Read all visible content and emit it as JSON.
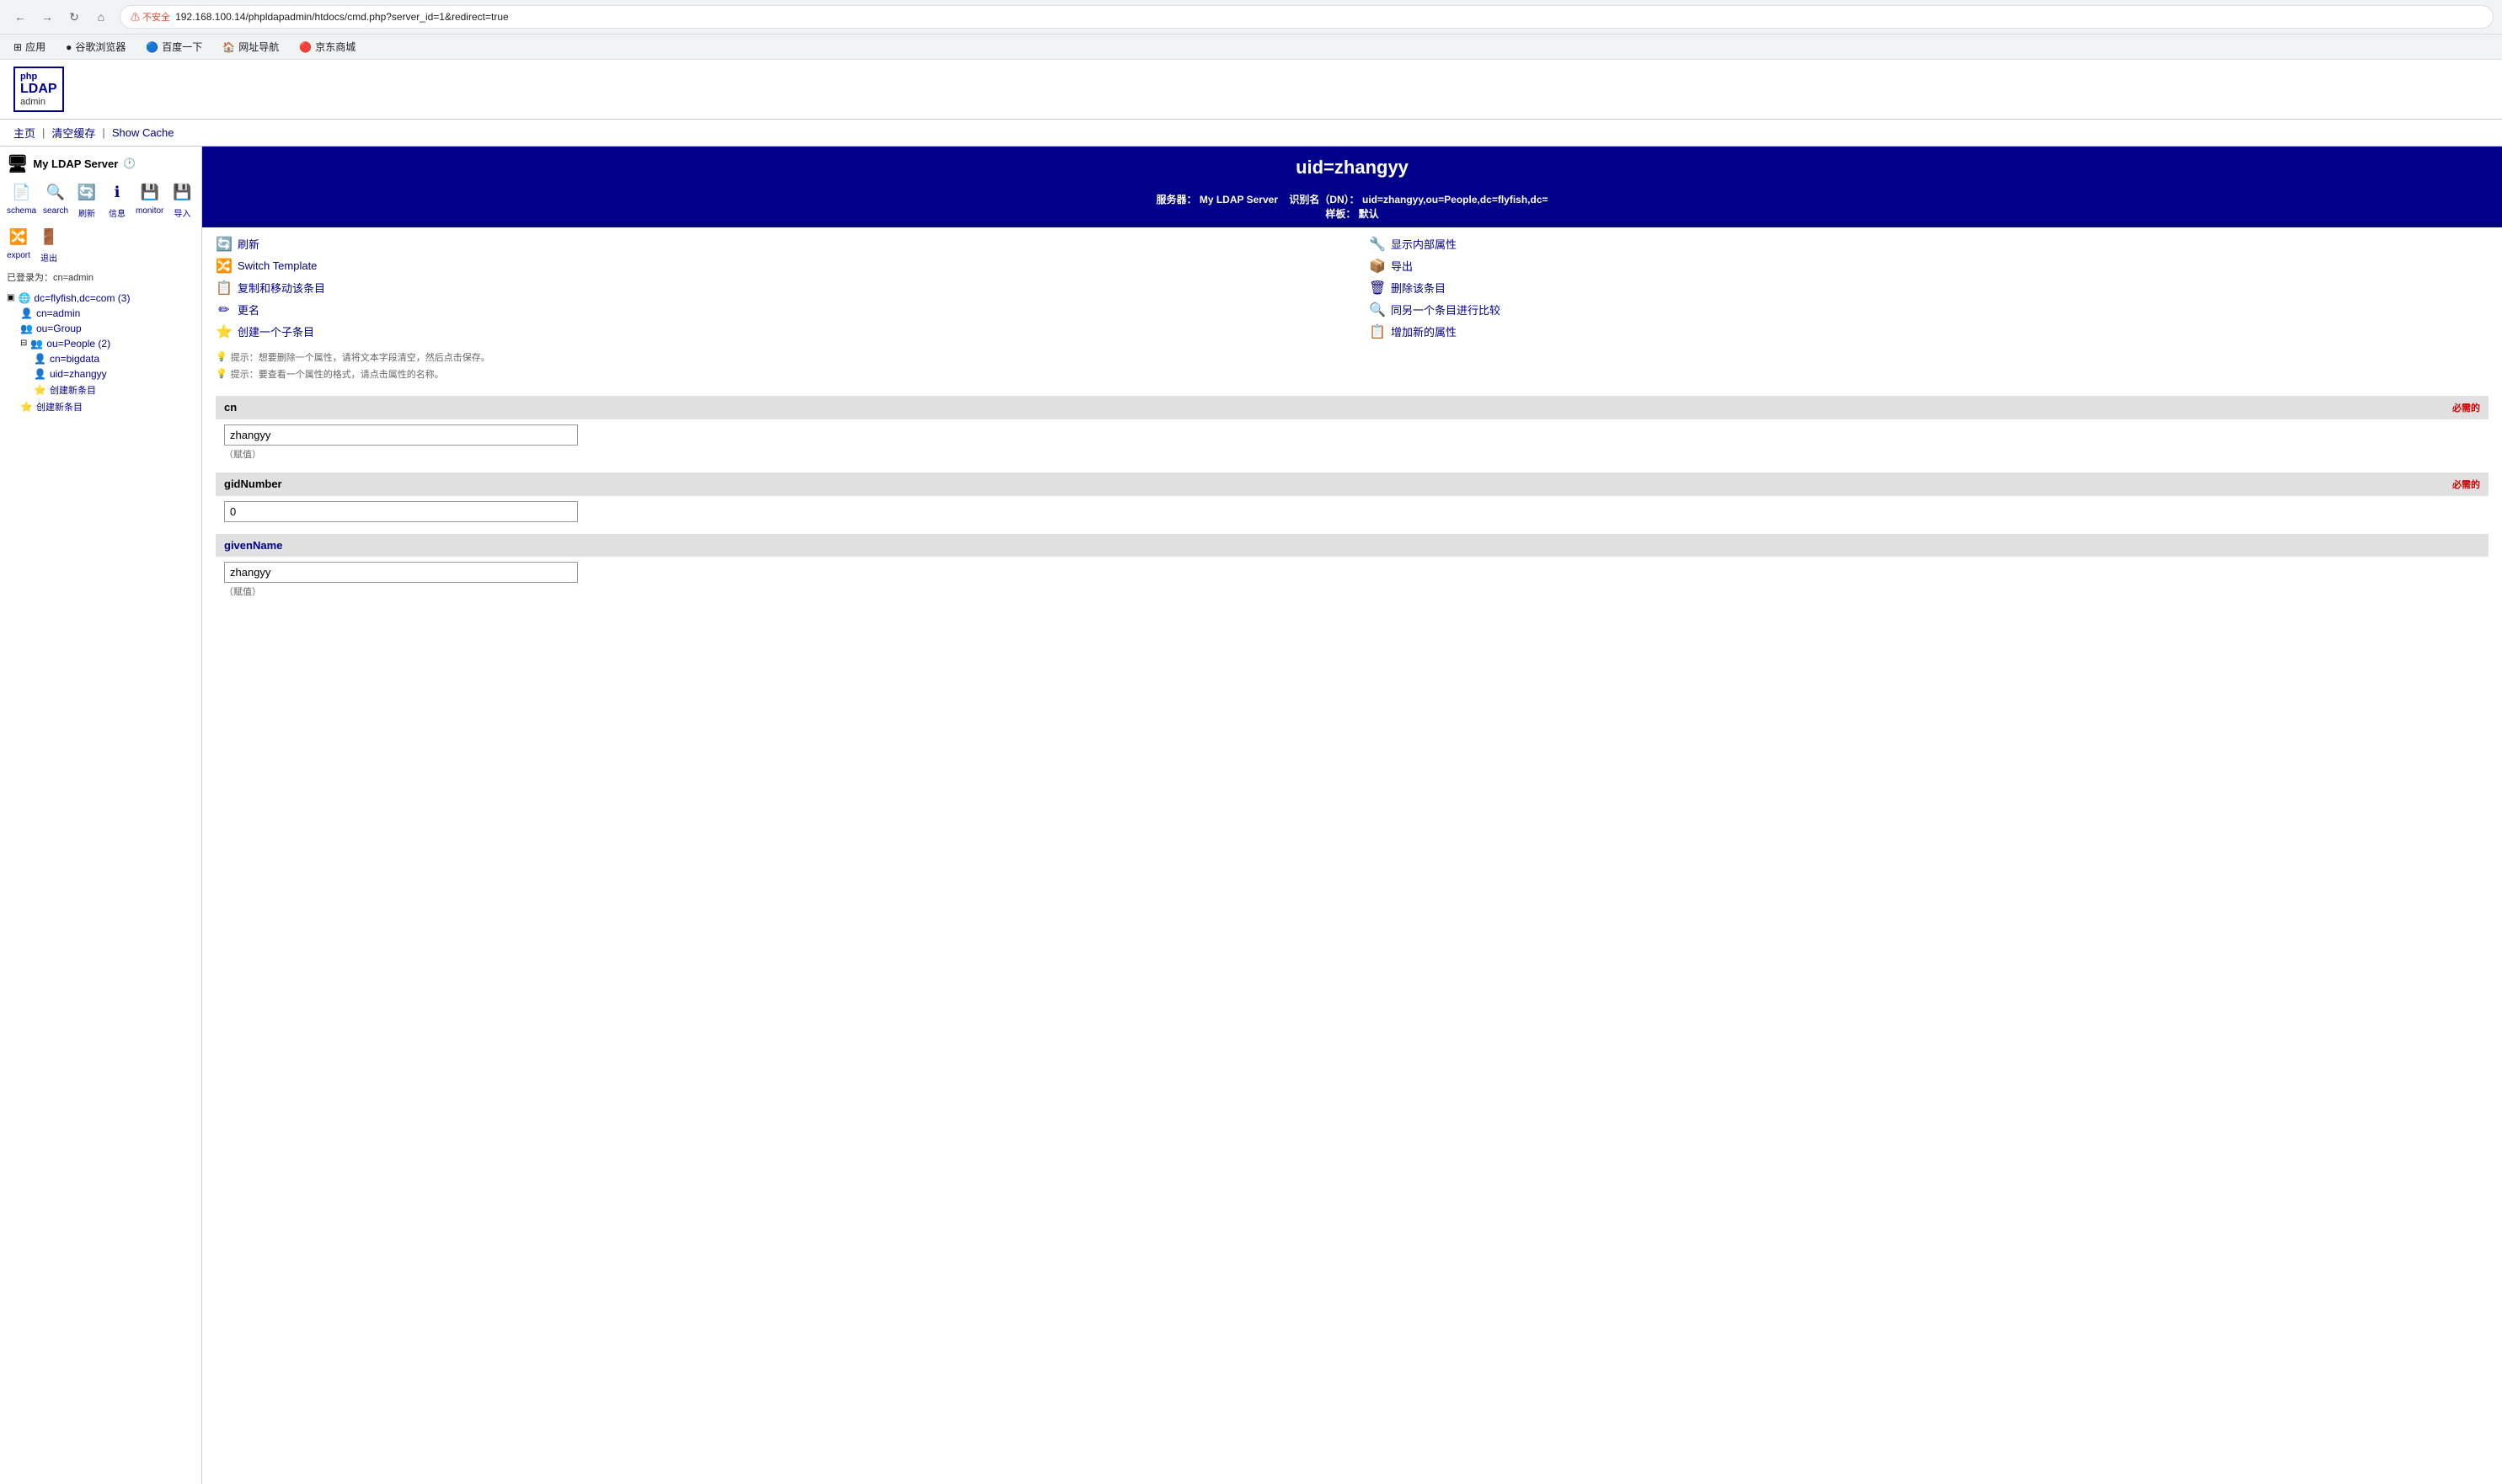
{
  "browser": {
    "back": "←",
    "forward": "→",
    "reload": "↻",
    "home": "⌂",
    "security_warning": "⚠ 不安全",
    "url": "192.168.100.14/phpldapadmin/htdocs/cmd.php?server_id=1&redirect=true",
    "bookmarks": [
      {
        "label": "应用",
        "icon": "⊞"
      },
      {
        "label": "谷歌浏览器",
        "icon": "●"
      },
      {
        "label": "百度一下",
        "icon": "🔵"
      },
      {
        "label": "网址导航",
        "icon": "🏠"
      },
      {
        "label": "京东商城",
        "icon": "🔴"
      }
    ]
  },
  "app": {
    "logo_php": "php",
    "logo_ldap": "LDAP",
    "logo_admin": "admin"
  },
  "nav": {
    "home": "主页",
    "clear_cache": "清空缓存",
    "show_cache": "Show Cache"
  },
  "sidebar": {
    "server_name": "My LDAP Server",
    "logged_in_label": "已登录为：",
    "logged_in_user": "cn=admin",
    "toolbar": [
      {
        "id": "schema",
        "label": "schema",
        "icon": "📄"
      },
      {
        "id": "search",
        "label": "search",
        "icon": "🔍"
      },
      {
        "id": "refresh",
        "label": "刷新",
        "icon": "🔄"
      },
      {
        "id": "info",
        "label": "信息",
        "icon": "ℹ"
      },
      {
        "id": "monitor",
        "label": "monitor",
        "icon": "💾"
      },
      {
        "id": "import",
        "label": "导入",
        "icon": "💾"
      },
      {
        "id": "export",
        "label": "export",
        "icon": "🔀"
      },
      {
        "id": "logout",
        "label": "退出",
        "icon": "🚪"
      }
    ],
    "tree": {
      "root": "dc=flyfish,dc=com (3)",
      "children": [
        {
          "id": "cn-admin",
          "label": "cn=admin",
          "icon": "👤",
          "indent": 1
        },
        {
          "id": "ou-group",
          "label": "ou=Group",
          "icon": "👥",
          "indent": 1
        },
        {
          "id": "ou-people",
          "label": "ou=People (2)",
          "icon": "👥",
          "indent": 1,
          "expanded": true,
          "children": [
            {
              "id": "cn-bigdata",
              "label": "cn=bigdata",
              "icon": "👤",
              "indent": 2
            },
            {
              "id": "uid-zhangyy",
              "label": "uid=zhangyy",
              "icon": "👤",
              "indent": 2
            }
          ]
        },
        {
          "id": "create-entry",
          "label": "创建新条目",
          "icon": "⭐",
          "indent": 2
        }
      ],
      "create_new": "创建新条目"
    }
  },
  "content": {
    "title": "uid=zhangyy",
    "server_label": "服务器：",
    "server_name": "My LDAP Server",
    "dn_label": "识别名（DN）：",
    "dn_value": "uid=zhangyy,ou=People,dc=flyfish,dc=",
    "template_label": "样板：",
    "template_value": "默认",
    "actions_left": [
      {
        "id": "refresh",
        "label": "刷新",
        "icon": "🔄"
      },
      {
        "id": "switch-template",
        "label": "Switch Template",
        "icon": "🔀"
      },
      {
        "id": "copy-move",
        "label": "复制和移动该条目",
        "icon": "📋"
      },
      {
        "id": "rename",
        "label": "更名",
        "icon": "✏"
      },
      {
        "id": "create-child",
        "label": "创建一个子条目",
        "icon": "⭐"
      }
    ],
    "actions_right": [
      {
        "id": "show-internal",
        "label": "显示内部属性",
        "icon": "🔧"
      },
      {
        "id": "export-entry",
        "label": "导出",
        "icon": "📦"
      },
      {
        "id": "delete-entry",
        "label": "删除该条目",
        "icon": "🗑"
      },
      {
        "id": "compare",
        "label": "同另一个条目进行比较",
        "icon": "🔍"
      },
      {
        "id": "add-attr",
        "label": "增加新的属性",
        "icon": "📋"
      }
    ],
    "hints": [
      "提示：想要删除一个属性，请将文本字段清空，然后点击保存。",
      "提示：要查看一个属性的格式，请点击属性的名称。"
    ],
    "fields": [
      {
        "id": "cn",
        "name": "cn",
        "required": "必需的",
        "value": "zhangyy",
        "note": "（赋值）"
      },
      {
        "id": "gidNumber",
        "name": "gidNumber",
        "required": "必需的",
        "value": "0",
        "note": ""
      },
      {
        "id": "givenName",
        "name": "givenName",
        "required": "",
        "value": "zhangyy",
        "note": "（赋值）",
        "is_link": true
      }
    ]
  }
}
